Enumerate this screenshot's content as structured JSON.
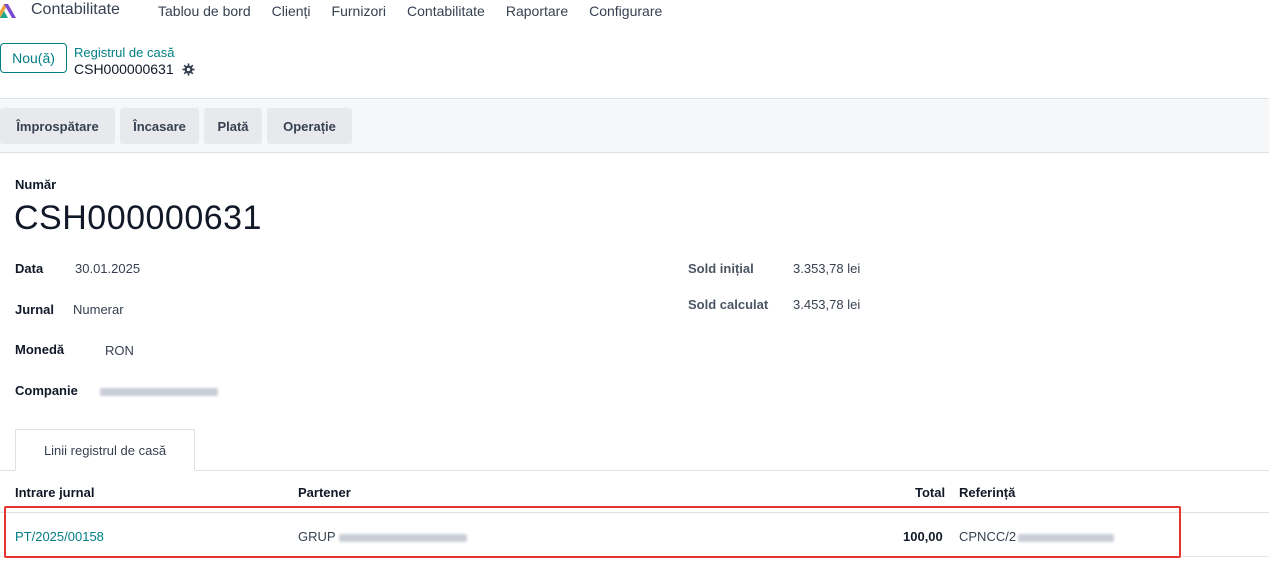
{
  "nav": {
    "app_name": "Contabilitate",
    "menu": [
      "Tablou de bord",
      "Clienți",
      "Furnizori",
      "Contabilitate",
      "Raportare",
      "Configurare"
    ]
  },
  "control": {
    "new_label": "Nou(ă)",
    "breadcrumb_parent": "Registrul de casă",
    "breadcrumb_current": "CSH000000631"
  },
  "actions": [
    "Împrospătare",
    "Încasare",
    "Plată",
    "Operație"
  ],
  "form": {
    "number_label": "Număr",
    "number_value": "CSH000000631",
    "date_label": "Data",
    "date_value": "30.01.2025",
    "journal_label": "Jurnal",
    "journal_value": "Numerar",
    "currency_label": "Monedă",
    "currency_value": "RON",
    "company_label": "Companie",
    "initial_balance_label": "Sold inițial",
    "initial_balance_value": "3.353,78 lei",
    "computed_balance_label": "Sold calculat",
    "computed_balance_value": "3.453,78 lei"
  },
  "tabs": [
    "Linii registrul de casă"
  ],
  "table": {
    "columns": [
      "Intrare jurnal",
      "Partener",
      "Total",
      "Referință"
    ],
    "rows": [
      {
        "entry": "PT/2025/00158",
        "partner": "GRUP",
        "total": "100,00",
        "reference": "CPNCC/2"
      }
    ]
  },
  "colors": {
    "accent": "#017e84",
    "highlight": "#e3342f"
  }
}
